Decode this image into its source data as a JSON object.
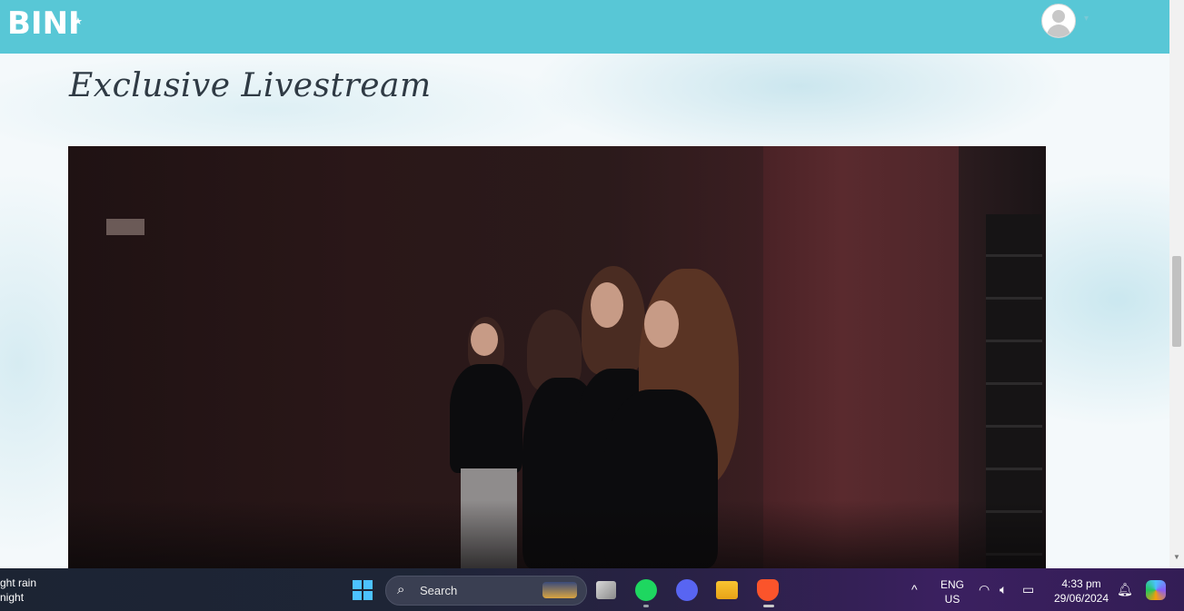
{
  "brand": {
    "logo_text": "BINI",
    "logo_star": "★"
  },
  "header": {
    "avatar_caret": "▾"
  },
  "main": {
    "title": "Exclusive Livestream"
  },
  "taskbar": {
    "weather_line1": "ght rain",
    "weather_line2": "night",
    "search_placeholder": "Search",
    "language": "ENG",
    "region": "US",
    "time": "4:33 pm",
    "date": "29/06/2024",
    "tray_chevron": "^"
  },
  "colors": {
    "header_bg": "#58c7d6",
    "accent": "#4cc2ff"
  }
}
